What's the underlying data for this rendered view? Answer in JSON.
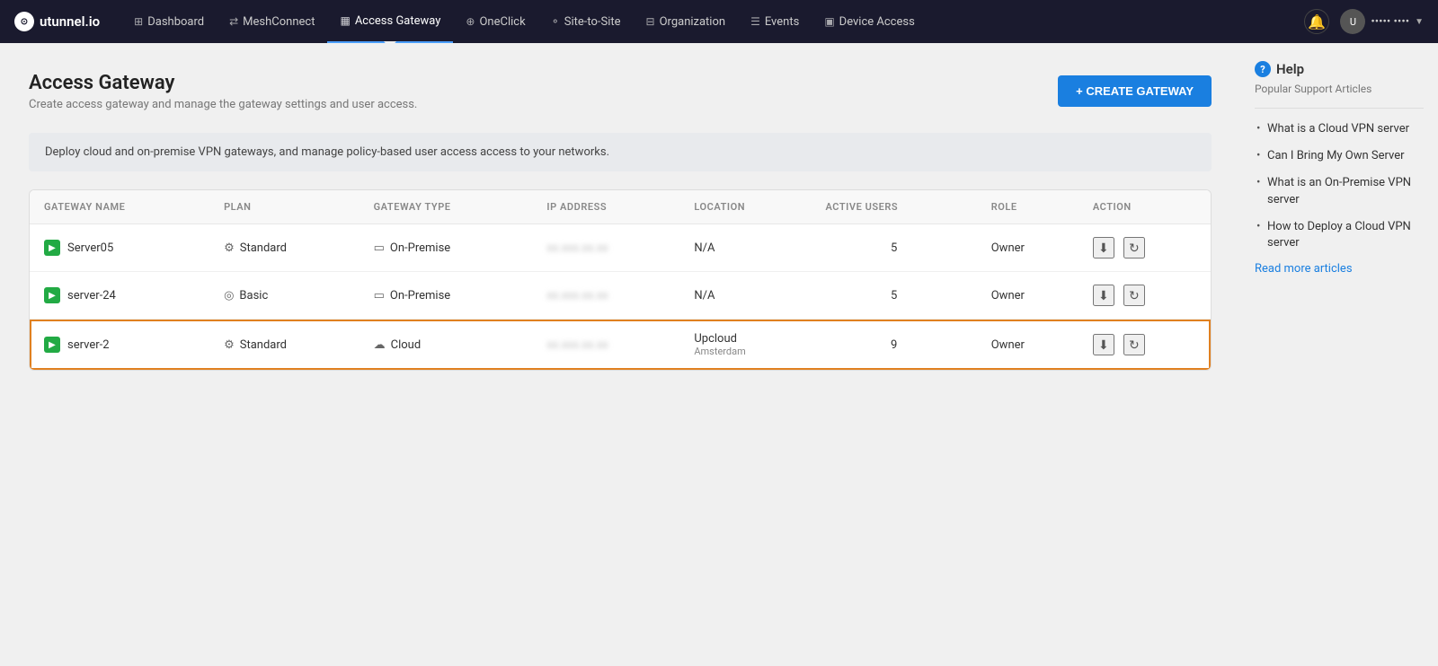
{
  "brand": {
    "logo_text": "utunnel.io",
    "logo_icon": "⊙"
  },
  "navbar": {
    "items": [
      {
        "id": "dashboard",
        "label": "Dashboard",
        "icon": "⊞",
        "active": false
      },
      {
        "id": "meshconnect",
        "label": "MeshConnect",
        "icon": "⇄",
        "active": false
      },
      {
        "id": "access-gateway",
        "label": "Access Gateway",
        "icon": "▦",
        "active": true
      },
      {
        "id": "oneclick",
        "label": "OneClick",
        "icon": "⊕",
        "active": false
      },
      {
        "id": "site-to-site",
        "label": "Site-to-Site",
        "icon": "⚬",
        "active": false
      },
      {
        "id": "organization",
        "label": "Organization",
        "icon": "⊟",
        "active": false
      },
      {
        "id": "events",
        "label": "Events",
        "icon": "☰",
        "active": false
      },
      {
        "id": "device-access",
        "label": "Device Access",
        "icon": "▣",
        "active": false
      }
    ],
    "bell_icon": "🔔",
    "user_name": "••••• ••••",
    "user_initials": "U"
  },
  "page": {
    "title": "Access Gateway",
    "subtitle": "Create access gateway and manage the gateway settings and user access.",
    "create_button": "+ CREATE GATEWAY",
    "info_banner": "Deploy cloud and on-premise VPN gateways, and manage policy-based user access access to your networks."
  },
  "table": {
    "columns": [
      {
        "id": "name",
        "label": "GATEWAY NAME"
      },
      {
        "id": "plan",
        "label": "PLAN"
      },
      {
        "id": "type",
        "label": "GATEWAY TYPE"
      },
      {
        "id": "ip",
        "label": "IP ADDRESS"
      },
      {
        "id": "location",
        "label": "LOCATION"
      },
      {
        "id": "users",
        "label": "ACTIVE USERS"
      },
      {
        "id": "role",
        "label": "ROLE"
      },
      {
        "id": "action",
        "label": "ACTION"
      }
    ],
    "rows": [
      {
        "id": "server05",
        "name": "Server05",
        "plan": "Standard",
        "type": "On-Premise",
        "ip": "xx.xxx.xx.xx",
        "location": "N/A",
        "location_sub": "",
        "users": "5",
        "role": "Owner",
        "selected": false
      },
      {
        "id": "server-24",
        "name": "server-24",
        "plan": "Basic",
        "type": "On-Premise",
        "ip": "xx.xxx.xx.xx",
        "location": "N/A",
        "location_sub": "",
        "users": "5",
        "role": "Owner",
        "selected": false
      },
      {
        "id": "server-2",
        "name": "server-2",
        "plan": "Standard",
        "type": "Cloud",
        "ip": "xx.xxx.xx.xx",
        "location": "Upcloud",
        "location_sub": "Amsterdam",
        "users": "9",
        "role": "Owner",
        "selected": true
      }
    ]
  },
  "help": {
    "title": "Help",
    "subtitle": "Popular Support Articles",
    "icon_text": "?",
    "articles": [
      "What is a Cloud VPN server",
      "Can I Bring My Own Server",
      "What is an On-Premise VPN server",
      "How to Deploy a Cloud VPN server"
    ],
    "read_more": "Read more articles"
  }
}
